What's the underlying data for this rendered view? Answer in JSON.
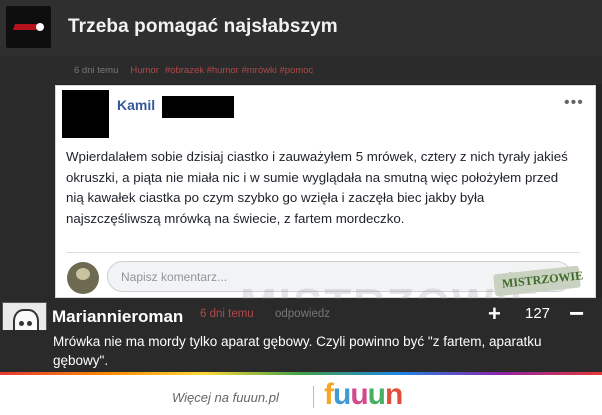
{
  "post": {
    "title": "Trzeba pomagać najsłabszym",
    "age": "6 dni temu",
    "category": "Humor",
    "tags": "#obrazek #humor #mrówki #pomoc"
  },
  "fb": {
    "author": "Kamil",
    "more": "•••",
    "text": "Wpierdalałem sobie dzisiaj ciastko i zauważyłem 5 mrówek, cztery z nich tyrały jakieś okruszki, a piąta nie miała nic i w sumie wyglądała na smutną więc położyłem przed nią kawałek ciastka po czym szybko go wzięła i zaczęła biec jakby była najszczęśliwszą mrówką na świecie, z fartem mordeczko.",
    "comment_placeholder": "Napisz komentarz...",
    "icons": [
      "emoji-icon",
      "camera-icon"
    ]
  },
  "watermark": {
    "text": "MISTRZOWIE",
    "badge": "MISTRZOWIE"
  },
  "comment": {
    "user": "Mariannieroman",
    "age": "6 dni temu",
    "reply_label": "odpowiedz",
    "plus": "+",
    "score": "127",
    "minus": "−",
    "text": "Mrówka nie ma mordy tylko aparat gębowy. Czyli powinno być \"z fartem, aparatku gębowy\"."
  },
  "footer": {
    "more": "Więcej na fuuun.pl",
    "brand": [
      "f",
      "u",
      "u",
      "u",
      "n"
    ]
  },
  "colors": {
    "accent_red": "#b24848",
    "fb_blue": "#365899",
    "bg": "#2a2a2a"
  }
}
